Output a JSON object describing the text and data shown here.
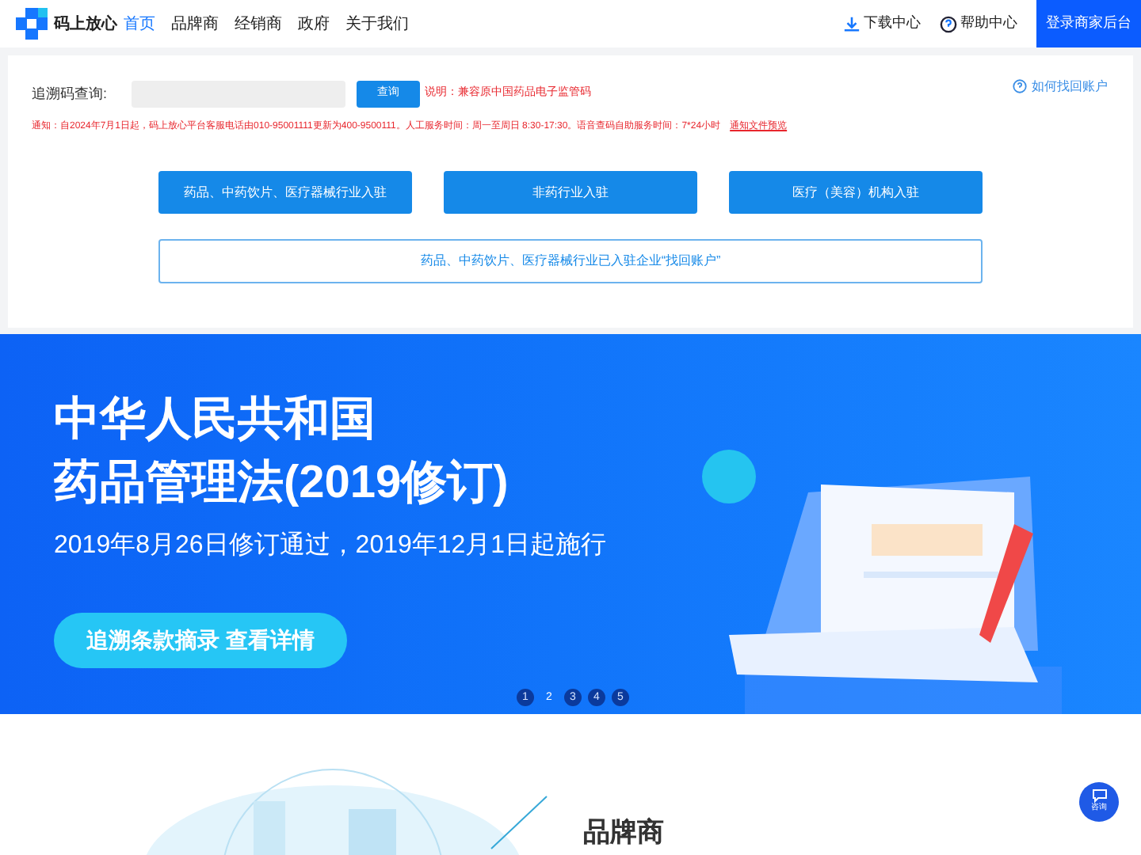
{
  "header": {
    "logo": "码上放心",
    "nav": [
      {
        "label": "首页",
        "selected": true
      },
      {
        "label": "品牌商",
        "selected": false
      },
      {
        "label": "经销商",
        "selected": false
      },
      {
        "label": "政府",
        "selected": false
      },
      {
        "label": "关于我们",
        "selected": false
      }
    ],
    "links": [
      "下载中心",
      "帮助中心"
    ],
    "login": "登录商家后台"
  },
  "search": {
    "label": "追溯码查询:",
    "button": "查询",
    "note": "说明：兼容原中国药品电子监管码",
    "help": "如何找回账户"
  },
  "notice": {
    "text": "通知：自2024年7月1日起，码上放心平台客服电话由010-95001111更新为400-9500111。人工服务时间：周一至周日 8:30-17:30。语音查码自助服务时间：7*24小时",
    "link": "通知文件预览"
  },
  "entry_buttons": [
    "药品、中药饮片、医疗器械行业入驻",
    "非药行业入驻",
    "医疗（美容）机构入驻"
  ],
  "recover_button": "药品、中药饮片、医疗器械行业已入驻企业“找回账户”",
  "banner": {
    "title": [
      "中华人民共和国",
      "药品管理法(2019修订)"
    ],
    "subtitle": "2019年8月26日修订通过，2019年12月1日起施行",
    "cta": "追溯条款摘录 查看详情",
    "dots": [
      {
        "label": "1",
        "selected": false
      },
      {
        "label": "2",
        "selected": true
      },
      {
        "label": "3",
        "selected": false
      },
      {
        "label": "4",
        "selected": false
      },
      {
        "label": "5",
        "selected": false
      }
    ]
  },
  "section": {
    "title": "品牌商"
  },
  "chat": {
    "label": "咨询"
  }
}
